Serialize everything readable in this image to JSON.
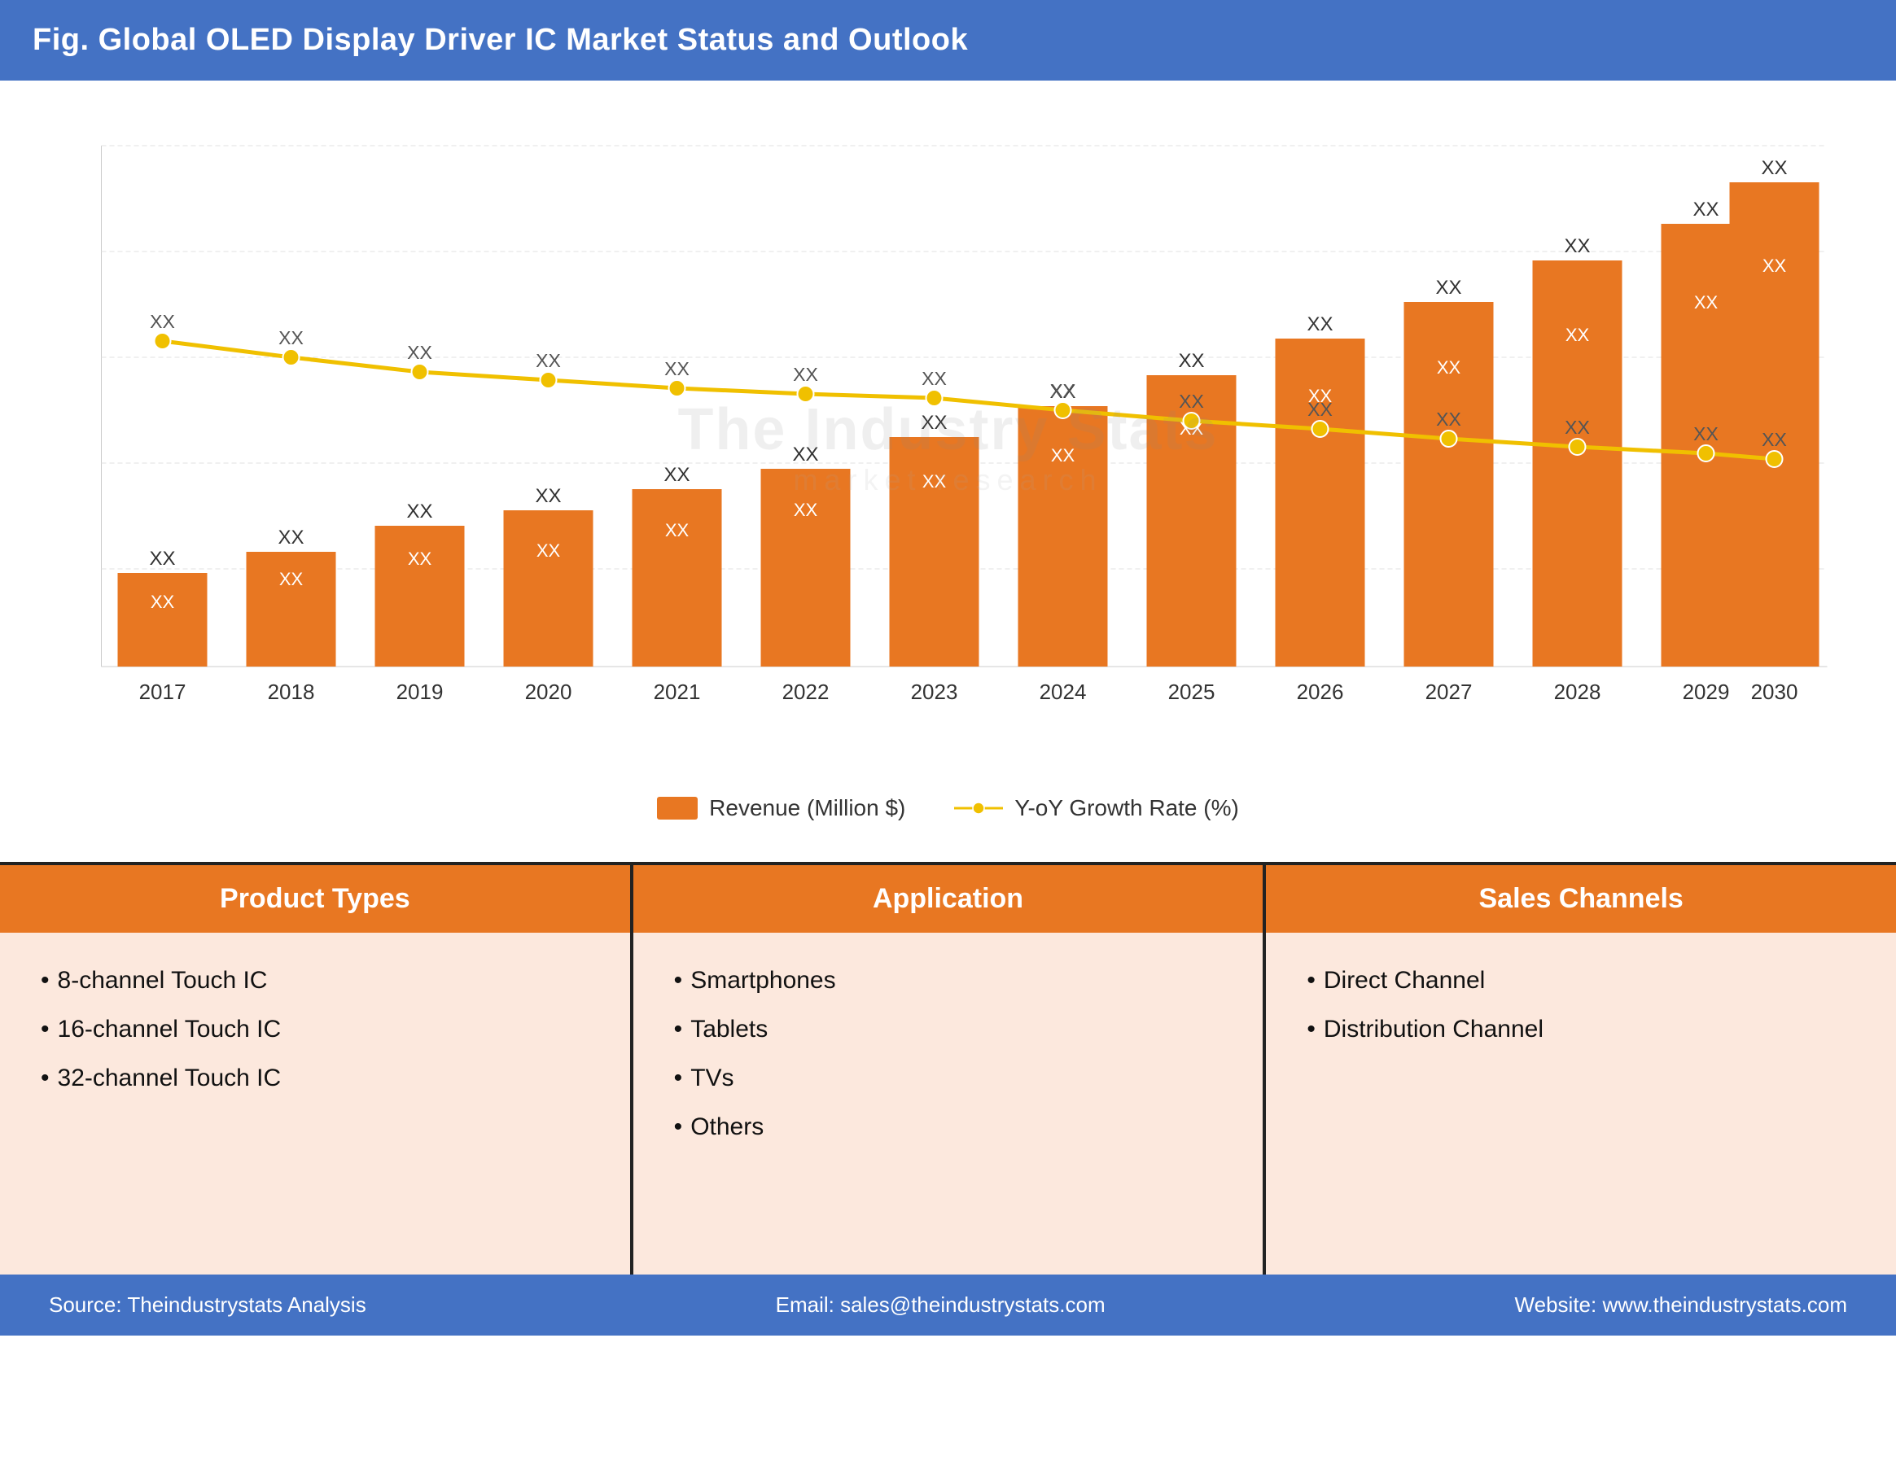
{
  "header": {
    "title": "Fig. Global OLED Display Driver IC Market Status and Outlook"
  },
  "chart": {
    "years": [
      "2017",
      "2018",
      "2019",
      "2020",
      "2021",
      "2022",
      "2023",
      "2024",
      "2025",
      "2026",
      "2027",
      "2028",
      "2029",
      "2030"
    ],
    "bar_label": "Revenue (Million $)",
    "line_label": "Y-oY Growth Rate (%)",
    "bar_color": "#e87722",
    "line_color": "#f0c000",
    "bar_heights_pct": [
      18,
      22,
      27,
      30,
      34,
      38,
      44,
      50,
      56,
      63,
      70,
      78,
      85,
      93
    ],
    "line_heights_pct": [
      62,
      58,
      55,
      54,
      52,
      51,
      50,
      47,
      45,
      43,
      40,
      38,
      37,
      35
    ],
    "bar_top_labels": [
      "XX",
      "XX",
      "XX",
      "XX",
      "XX",
      "XX",
      "XX",
      "XX",
      "XX",
      "XX",
      "XX",
      "XX",
      "XX",
      "XX"
    ],
    "bar_mid_labels": [
      "XX",
      "XX",
      "XX",
      "XX",
      "XX",
      "XX",
      "XX",
      "XX",
      "XX",
      "XX",
      "XX",
      "XX",
      "XX",
      "XX"
    ],
    "line_labels": [
      "XX",
      "XX",
      "XX",
      "XX",
      "XX",
      "XX",
      "XX",
      "XX",
      "XX",
      "XX",
      "XX",
      "XX",
      "XX",
      "XX"
    ]
  },
  "bottom": {
    "col1": {
      "header": "Product Types",
      "items": [
        "8-channel Touch IC",
        "16-channel Touch IC",
        "32-channel Touch IC"
      ]
    },
    "col2": {
      "header": "Application",
      "items": [
        "Smartphones",
        "Tablets",
        "TVs",
        "Others"
      ]
    },
    "col3": {
      "header": "Sales Channels",
      "items": [
        "Direct Channel",
        "Distribution Channel"
      ]
    }
  },
  "footer": {
    "source": "Source: Theindustrystats Analysis",
    "email": "Email: sales@theindustrystats.com",
    "website": "Website: www.theindustrystats.com"
  },
  "watermark": {
    "line1": "The Industry Stats",
    "line2": "market  research"
  }
}
